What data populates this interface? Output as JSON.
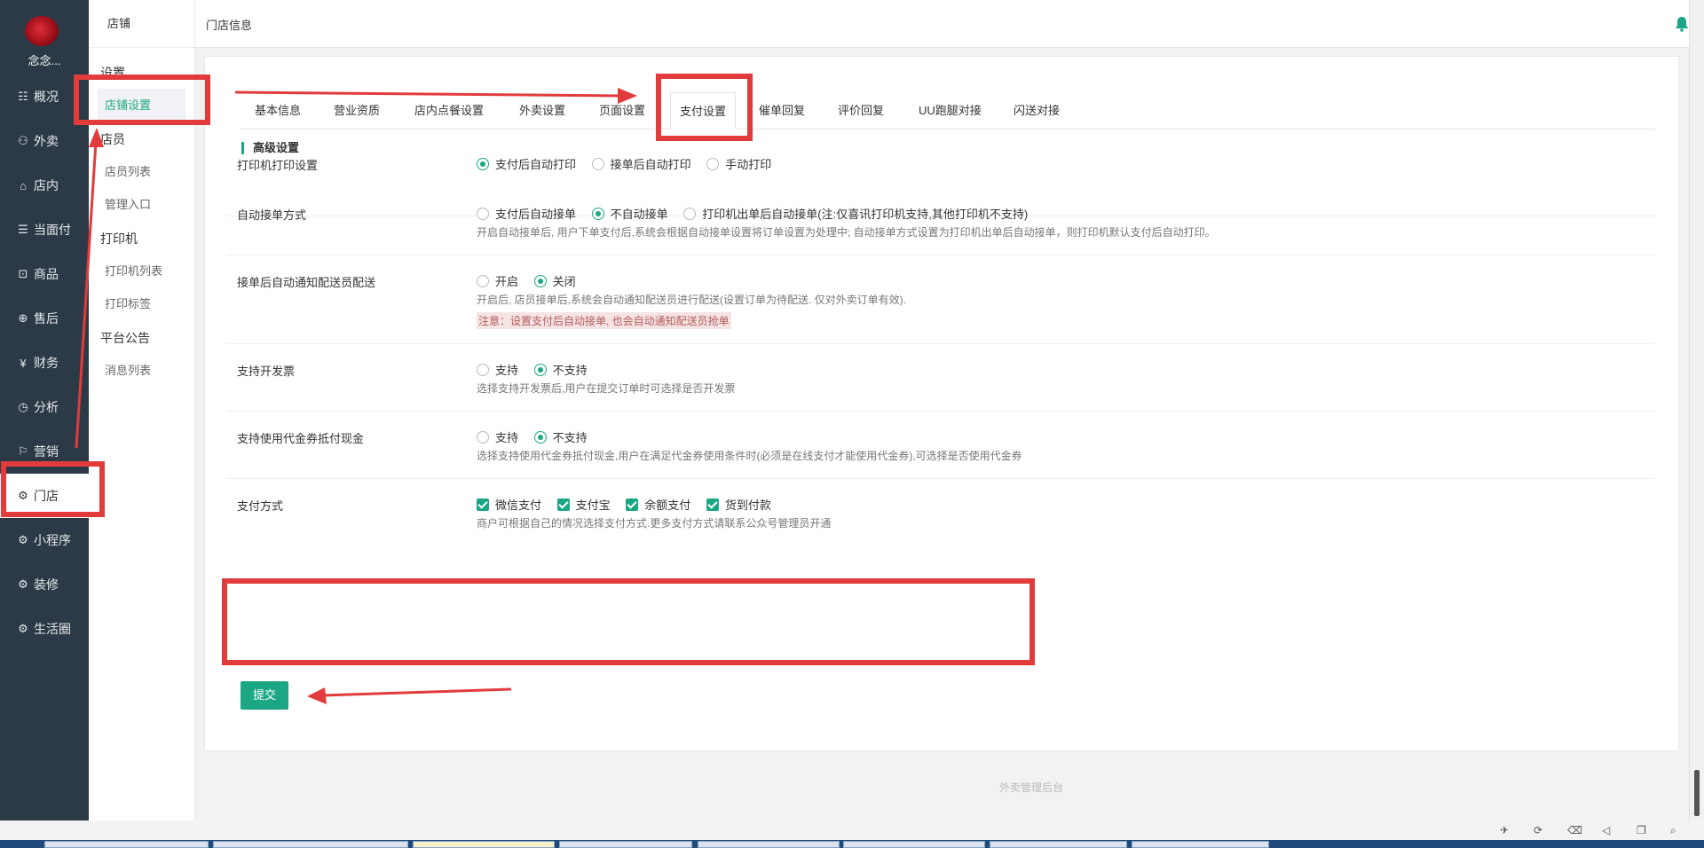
{
  "shop": {
    "name": "念念..."
  },
  "nav": [
    {
      "icon": "overview-icon",
      "glyph": "☷",
      "label": "概况"
    },
    {
      "icon": "delivery-icon",
      "glyph": "⚇",
      "label": "外卖"
    },
    {
      "icon": "store-icon",
      "glyph": "⌂",
      "label": "店内"
    },
    {
      "icon": "pay-icon",
      "glyph": "☰",
      "label": "当面付"
    },
    {
      "icon": "goods-icon",
      "glyph": "⊡",
      "label": "商品"
    },
    {
      "icon": "aftersale-icon",
      "glyph": "⊕",
      "label": "售后"
    },
    {
      "icon": "finance-icon",
      "glyph": "¥",
      "label": "财务"
    },
    {
      "icon": "analysis-icon",
      "glyph": "◷",
      "label": "分析"
    },
    {
      "icon": "marketing-icon",
      "glyph": "⚐",
      "label": "营销"
    },
    {
      "icon": "gear-icon",
      "glyph": "⚙",
      "label": "门店"
    },
    {
      "icon": "gear-icon",
      "glyph": "⚙",
      "label": "小程序"
    },
    {
      "icon": "gear-icon",
      "glyph": "⚙",
      "label": "装修"
    },
    {
      "icon": "gear-icon",
      "glyph": "⚙",
      "label": "生活圈"
    }
  ],
  "sub_nav": {
    "header": "店铺",
    "group_settings": "设置",
    "store_settings": "店铺设置",
    "group_staff": "店员",
    "staff_list": "店员列表",
    "admin_entry": "管理入口",
    "group_printer": "打印机",
    "printer_list": "打印机列表",
    "print_label": "打印标签",
    "group_notice": "平台公告",
    "message_list": "消息列表"
  },
  "topbar": {
    "title": "门店信息"
  },
  "tabs": [
    "基本信息",
    "营业资质",
    "店内点餐设置",
    "外卖设置",
    "页面设置",
    "支付设置",
    "催单回复",
    "评价回复",
    "UU跑腿对接",
    "闪送对接"
  ],
  "section_title": "高级设置",
  "printer": {
    "label": "打印机打印设置",
    "options": [
      "支付后自动打印",
      "接单后自动打印",
      "手动打印"
    ],
    "selected": 0
  },
  "auto_accept": {
    "label": "自动接单方式",
    "options": [
      "支付后自动接单",
      "不自动接单",
      "打印机出单后自动接单(注:仅喜讯打印机支持,其他打印机不支持)"
    ],
    "selected": 1,
    "desc": "开启自动接单后, 用户下单支付后,系统会根据自动接单设置将订单设置为处理中; 自动接单方式设置为打印机出单后自动接单，则打印机默认支付后自动打印。"
  },
  "notify_delivery": {
    "label": "接单后自动通知配送员配送",
    "options": [
      "开启",
      "关闭"
    ],
    "selected": 1,
    "desc": "开启后, 店员接单后,系统会自动通知配送员进行配送(设置订单为待配送. 仅对外卖订单有效).",
    "warning": "注意：设置支付后自动接单, 也会自动通知配送员抢单"
  },
  "invoice": {
    "label": "支持开发票",
    "options": [
      "支持",
      "不支持"
    ],
    "selected": 1,
    "desc": "选择支持开发票后,用户在提交订单时可选择是否开发票"
  },
  "voucher": {
    "label": "支持使用代金券抵付现金",
    "options": [
      "支持",
      "不支持"
    ],
    "selected": 1,
    "desc": "选择支持使用代金券抵付现金,用户在满足代金券使用条件时(必须是在线支付才能使用代金券),可选择是否使用代金券"
  },
  "payment": {
    "label": "支付方式",
    "options": [
      "微信支付",
      "支付宝",
      "余额支付",
      "货到付款"
    ],
    "desc": "商户可根据自己的情况选择支付方式.更多支付方式请联系公众号管理员开通"
  },
  "submit_label": "提交",
  "footer": "外卖管理后台",
  "colors": {
    "accent": "#1ba784",
    "sidebar": "#2b3a46",
    "annotation": "#e23b3b"
  }
}
